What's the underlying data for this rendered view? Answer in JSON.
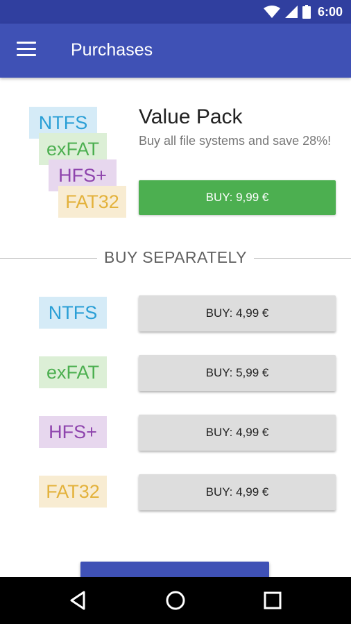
{
  "status": {
    "time": "6:00",
    "icons": [
      "wifi-icon",
      "cell-signal-icon",
      "battery-icon"
    ]
  },
  "appbar": {
    "title": "Purchases",
    "menu_icon": "menu-icon"
  },
  "value_pack": {
    "title": "Value Pack",
    "description": "Buy all file systems and save 28%!",
    "button_label": "BUY: 9,99 €",
    "logos": [
      "NTFS",
      "exFAT",
      "HFS+",
      "FAT32"
    ]
  },
  "separator": {
    "label": "BUY SEPARATELY"
  },
  "items": [
    {
      "name": "NTFS",
      "button_label": "BUY: 4,99 €"
    },
    {
      "name": "exFAT",
      "button_label": "BUY: 5,99 €"
    },
    {
      "name": "HFS+",
      "button_label": "BUY: 4,99 €"
    },
    {
      "name": "FAT32",
      "button_label": "BUY: 4,99 €"
    }
  ],
  "navbar": {
    "buttons": [
      "back-icon",
      "home-icon",
      "recents-icon"
    ]
  },
  "colors": {
    "statusbar": "#303f9f",
    "appbar": "#3f51b5",
    "buy_pack": "#4caf50",
    "buy_single": "#dddddd",
    "ntfs": "#2a9fd6",
    "exfat": "#4caf50",
    "hfs": "#8e44ad",
    "fat32": "#e3b23c"
  }
}
